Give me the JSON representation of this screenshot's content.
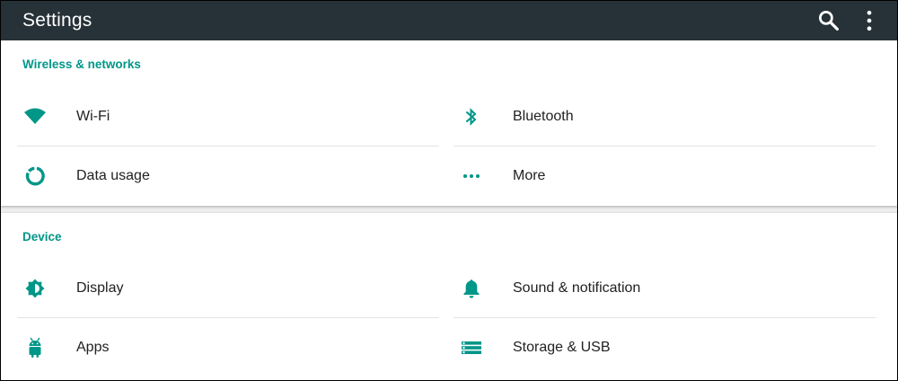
{
  "toolbar": {
    "title": "Settings",
    "background": "#263238",
    "actions": [
      {
        "icon": "search-icon"
      },
      {
        "icon": "overflow-menu-icon"
      }
    ]
  },
  "accent_color": "#009688",
  "categories": [
    {
      "title": "Wireless & networks",
      "items": [
        {
          "label": "Wi-Fi",
          "icon": "wifi-icon"
        },
        {
          "label": "Bluetooth",
          "icon": "bluetooth-icon"
        },
        {
          "label": "Data usage",
          "icon": "data-usage-icon"
        },
        {
          "label": "More",
          "icon": "more-horiz-icon"
        }
      ]
    },
    {
      "title": "Device",
      "items": [
        {
          "label": "Display",
          "icon": "brightness-icon"
        },
        {
          "label": "Sound & notification",
          "icon": "bell-icon"
        },
        {
          "label": "Apps",
          "icon": "android-icon"
        },
        {
          "label": "Storage & USB",
          "icon": "storage-icon"
        }
      ]
    }
  ]
}
